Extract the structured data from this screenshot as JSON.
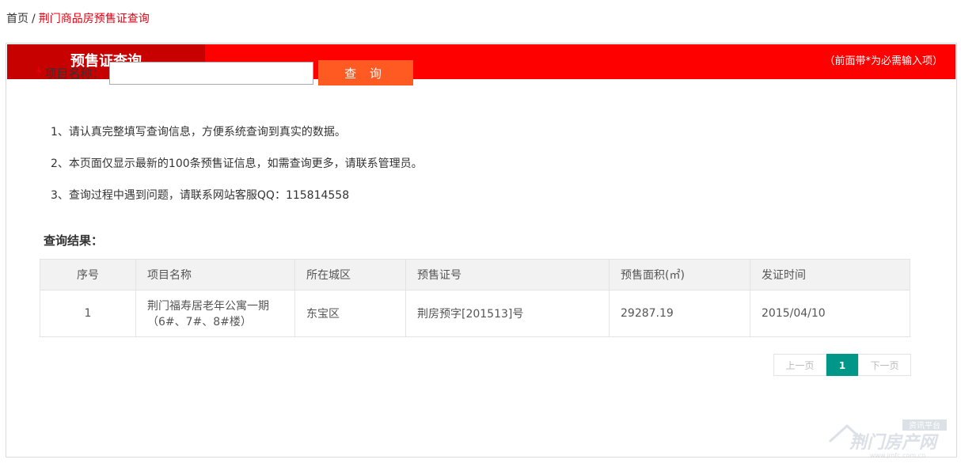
{
  "breadcrumb": {
    "home": "首页",
    "separator": "/",
    "current": "荆门商品房预售证查询"
  },
  "panel": {
    "title": "预售证查询",
    "note": "（前面带*为必需输入项）"
  },
  "form": {
    "required_mark": "*",
    "label": "项目名称：",
    "input_value": "",
    "input_placeholder": "",
    "button_label": "查 询"
  },
  "notes": [
    "1、请认真完整填写查询信息，方便系统查询到真实的数据。",
    "2、本页面仅显示最新的100条预售证信息，如需查询更多，请联系管理员。",
    "3、查询过程中遇到问题，请联系网站客服QQ：115814558"
  ],
  "results": {
    "title": "查询结果：",
    "columns": [
      "序号",
      "项目名称",
      "所在城区",
      "预售证号",
      "预售面积(㎡)",
      "发证时间"
    ],
    "rows": [
      {
        "index": "1",
        "name_line1": "荆门福寿居老年公寓一期",
        "name_line2": "（6#、7#、8#楼）",
        "district": "东宝区",
        "cert": "荆房预字[201513]号",
        "area": "29287.19",
        "date": "2015/04/10"
      }
    ]
  },
  "pager": {
    "prev": "上一页",
    "current": "1",
    "next": "下一页"
  },
  "watermark": {
    "tag": "资讯平台",
    "brand": "荆门房产网",
    "url": "www.jmfc.com.cn"
  },
  "colors": {
    "header_red": "#fe0000",
    "header_tab": "#c70000",
    "button_orange": "#ff5a22",
    "pager_active": "#009688",
    "breadcrumb_current": "#e60012"
  }
}
